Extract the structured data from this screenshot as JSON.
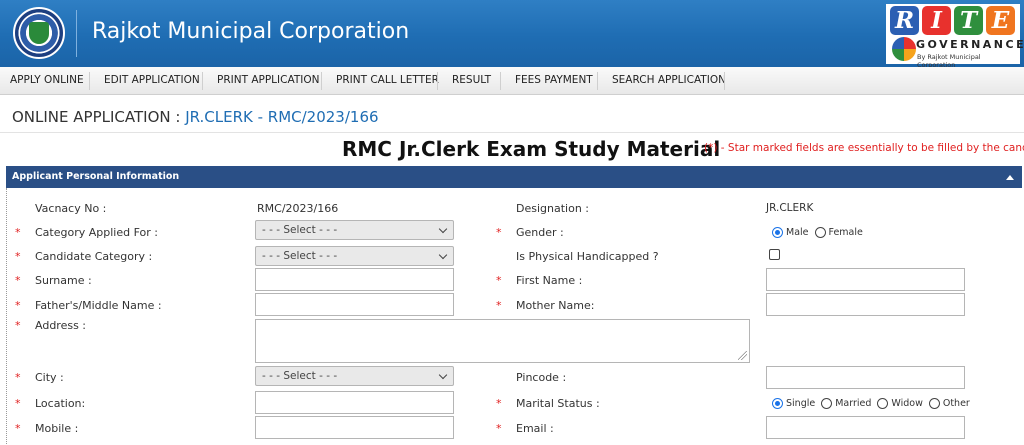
{
  "header": {
    "title": "Rajkot Municipal Corporation",
    "logo_icon": "rmc-emblem-icon",
    "rite": {
      "letters": [
        "R",
        "I",
        "T",
        "E"
      ],
      "letter_colors": [
        "#2b5fb3",
        "#e8312d",
        "#2f8f3d",
        "#f0751f"
      ],
      "governance": "GOVERNANCE",
      "byline": "By Rajkot Municipal Corporation"
    },
    "accent": "#1f6db3"
  },
  "nav": {
    "items": [
      "APPLY ONLINE",
      "EDIT APPLICATION",
      "PRINT APPLICATION",
      "PRINT CALL LETTER",
      "RESULT",
      "FEES PAYMENT",
      "SEARCH APPLICATION"
    ]
  },
  "page": {
    "heading_prefix": "ONLINE APPLICATION : ",
    "heading_link": "JR.CLERK - RMC/2023/166",
    "study_title": "RMC Jr.Clerk Exam Study Material",
    "star_note": "(*) - Star marked fields are essentially to be filled by the candidat"
  },
  "panel": {
    "title": "Applicant Personal Information",
    "collapse_icon": "caret-up-icon"
  },
  "form": {
    "star": "*",
    "vacancy_label": "Vacnacy No :",
    "vacancy_value": "RMC/2023/166",
    "designation_label": "Designation :",
    "designation_value": "JR.CLERK",
    "category_label": "Category Applied For :",
    "category_value": "- - - Select - - -",
    "gender_label": "Gender :",
    "gender_male": "Male",
    "gender_female": "Female",
    "gender_selected": "Male",
    "candidate_category_label": "Candidate Category :",
    "candidate_category_value": "- - - Select - - -",
    "handicap_label": "Is Physical Handicapped ?",
    "surname_label": "Surname :",
    "surname_value": "",
    "first_name_label": "First Name :",
    "first_name_value": "",
    "father_label": "Father's/Middle Name :",
    "father_value": "",
    "mother_label": "Mother Name:",
    "mother_value": "",
    "address_label": "Address :",
    "address_value": "",
    "city_label": "City :",
    "city_value": "- - - Select - - -",
    "pincode_label": "Pincode :",
    "pincode_value": "",
    "location_label": "Location:",
    "location_value": "",
    "marital_label": "Marital Status :",
    "marital_options": [
      "Single",
      "Married",
      "Widow",
      "Other"
    ],
    "marital_selected": "Single",
    "mobile_label": "Mobile :",
    "mobile_value": "",
    "email_label": "Email :",
    "email_value": ""
  }
}
